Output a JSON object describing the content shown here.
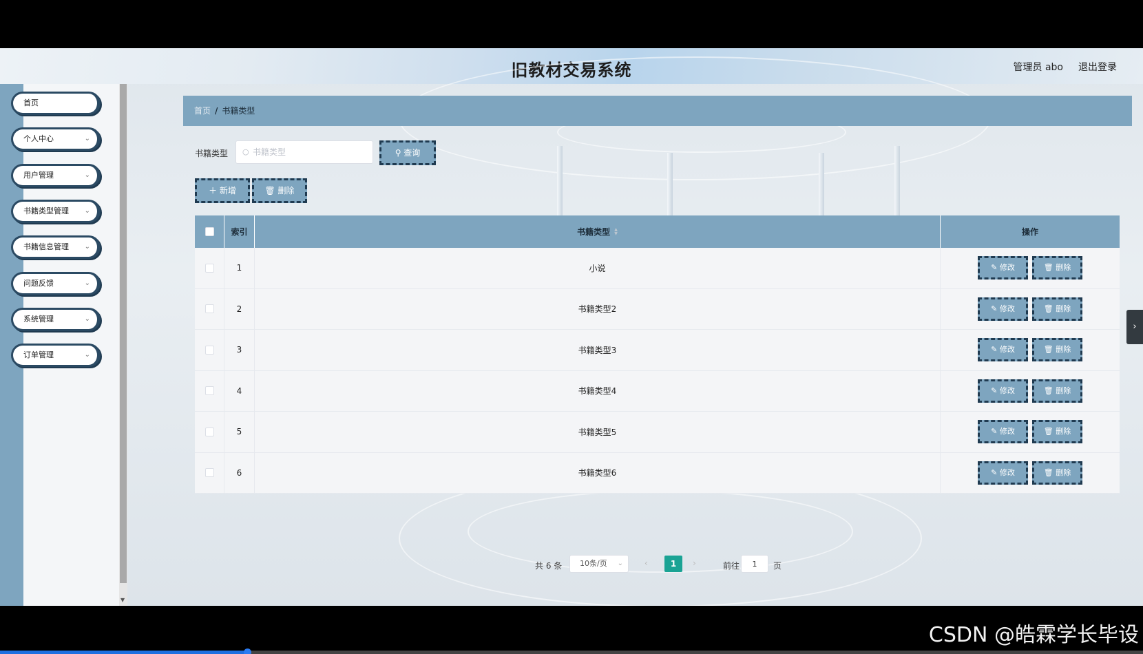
{
  "header": {
    "title": "旧教材交易系统",
    "user": "管理员 abo",
    "logout": "退出登录"
  },
  "sidebar": {
    "items": [
      {
        "label": "首页",
        "expandable": false
      },
      {
        "label": "个人中心",
        "expandable": true
      },
      {
        "label": "用户管理",
        "expandable": true
      },
      {
        "label": "书籍类型管理",
        "expandable": true
      },
      {
        "label": "书籍信息管理",
        "expandable": true
      },
      {
        "label": "问题反馈",
        "expandable": true
      },
      {
        "label": "系统管理",
        "expandable": true
      },
      {
        "label": "订单管理",
        "expandable": true
      }
    ]
  },
  "breadcrumb": {
    "home": "首页",
    "separator": "/",
    "current": "书籍类型"
  },
  "search": {
    "label": "书籍类型",
    "placeholder": "书籍类型",
    "query_label": "查询"
  },
  "toolbar": {
    "add_label": "新增",
    "delete_label": "删除"
  },
  "table": {
    "columns": {
      "index": "索引",
      "type": "书籍类型",
      "ops": "操作"
    },
    "edit_label": "修改",
    "delete_label": "删除",
    "rows": [
      {
        "index": "1",
        "type": "小说"
      },
      {
        "index": "2",
        "type": "书籍类型2"
      },
      {
        "index": "3",
        "type": "书籍类型3"
      },
      {
        "index": "4",
        "type": "书籍类型4"
      },
      {
        "index": "5",
        "type": "书籍类型5"
      },
      {
        "index": "6",
        "type": "书籍类型6"
      }
    ]
  },
  "pager": {
    "total": "共 6 条",
    "page_size": "10条/页",
    "current_page": "1",
    "goto_label": "前往",
    "goto_value": "1",
    "page_suffix": "页"
  },
  "watermark": "CSDN @皓霖学长毕设",
  "colors": {
    "accent": "#7ea5bf",
    "border_dark": "#1f3a50",
    "pager_active": "#1aa394"
  },
  "icons": {
    "search": "search-icon",
    "add": "plus-icon",
    "delete": "trash-icon",
    "edit": "edit-icon",
    "chevron": "chevron-down-icon"
  }
}
